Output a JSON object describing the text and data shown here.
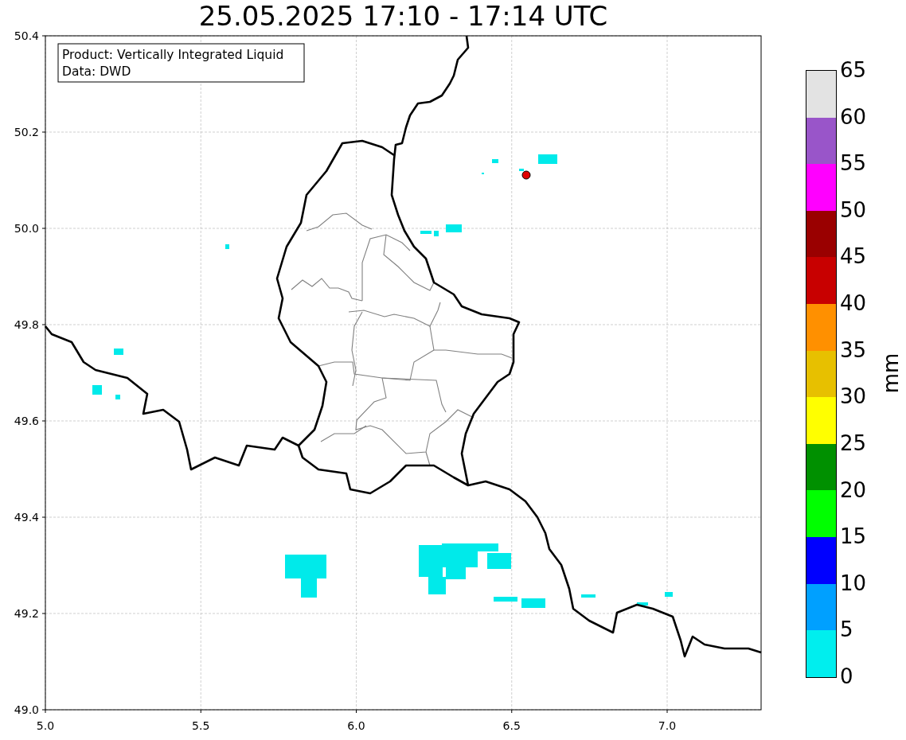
{
  "title": "25.05.2025 17:10 - 17:14 UTC",
  "legend": [
    "Product: Vertically Integrated Liquid",
    "Data: DWD"
  ],
  "x_ticks": [
    "5.0",
    "5.5",
    "6.0",
    "6.5",
    "7.0"
  ],
  "y_ticks": [
    "50.4",
    "50.2",
    "50.0",
    "49.8",
    "49.6",
    "49.4",
    "49.2",
    "49.0"
  ],
  "colorbar": {
    "label": "mm",
    "segments": [
      {
        "color": "#e3e3e3"
      },
      {
        "color": "#9955c9"
      },
      {
        "color": "#ff00ff"
      },
      {
        "color": "#9a0000"
      },
      {
        "color": "#c80000"
      },
      {
        "color": "#ff9000"
      },
      {
        "color": "#e7c000"
      },
      {
        "color": "#ffff00"
      },
      {
        "color": "#009000"
      },
      {
        "color": "#00ff00"
      },
      {
        "color": "#0000ff"
      },
      {
        "color": "#00a0ff"
      },
      {
        "color": "#00eeee"
      }
    ],
    "ticks": [
      "65",
      "60",
      "55",
      "50",
      "45",
      "40",
      "35",
      "30",
      "25",
      "20",
      "15",
      "10",
      "5",
      "0"
    ]
  }
}
